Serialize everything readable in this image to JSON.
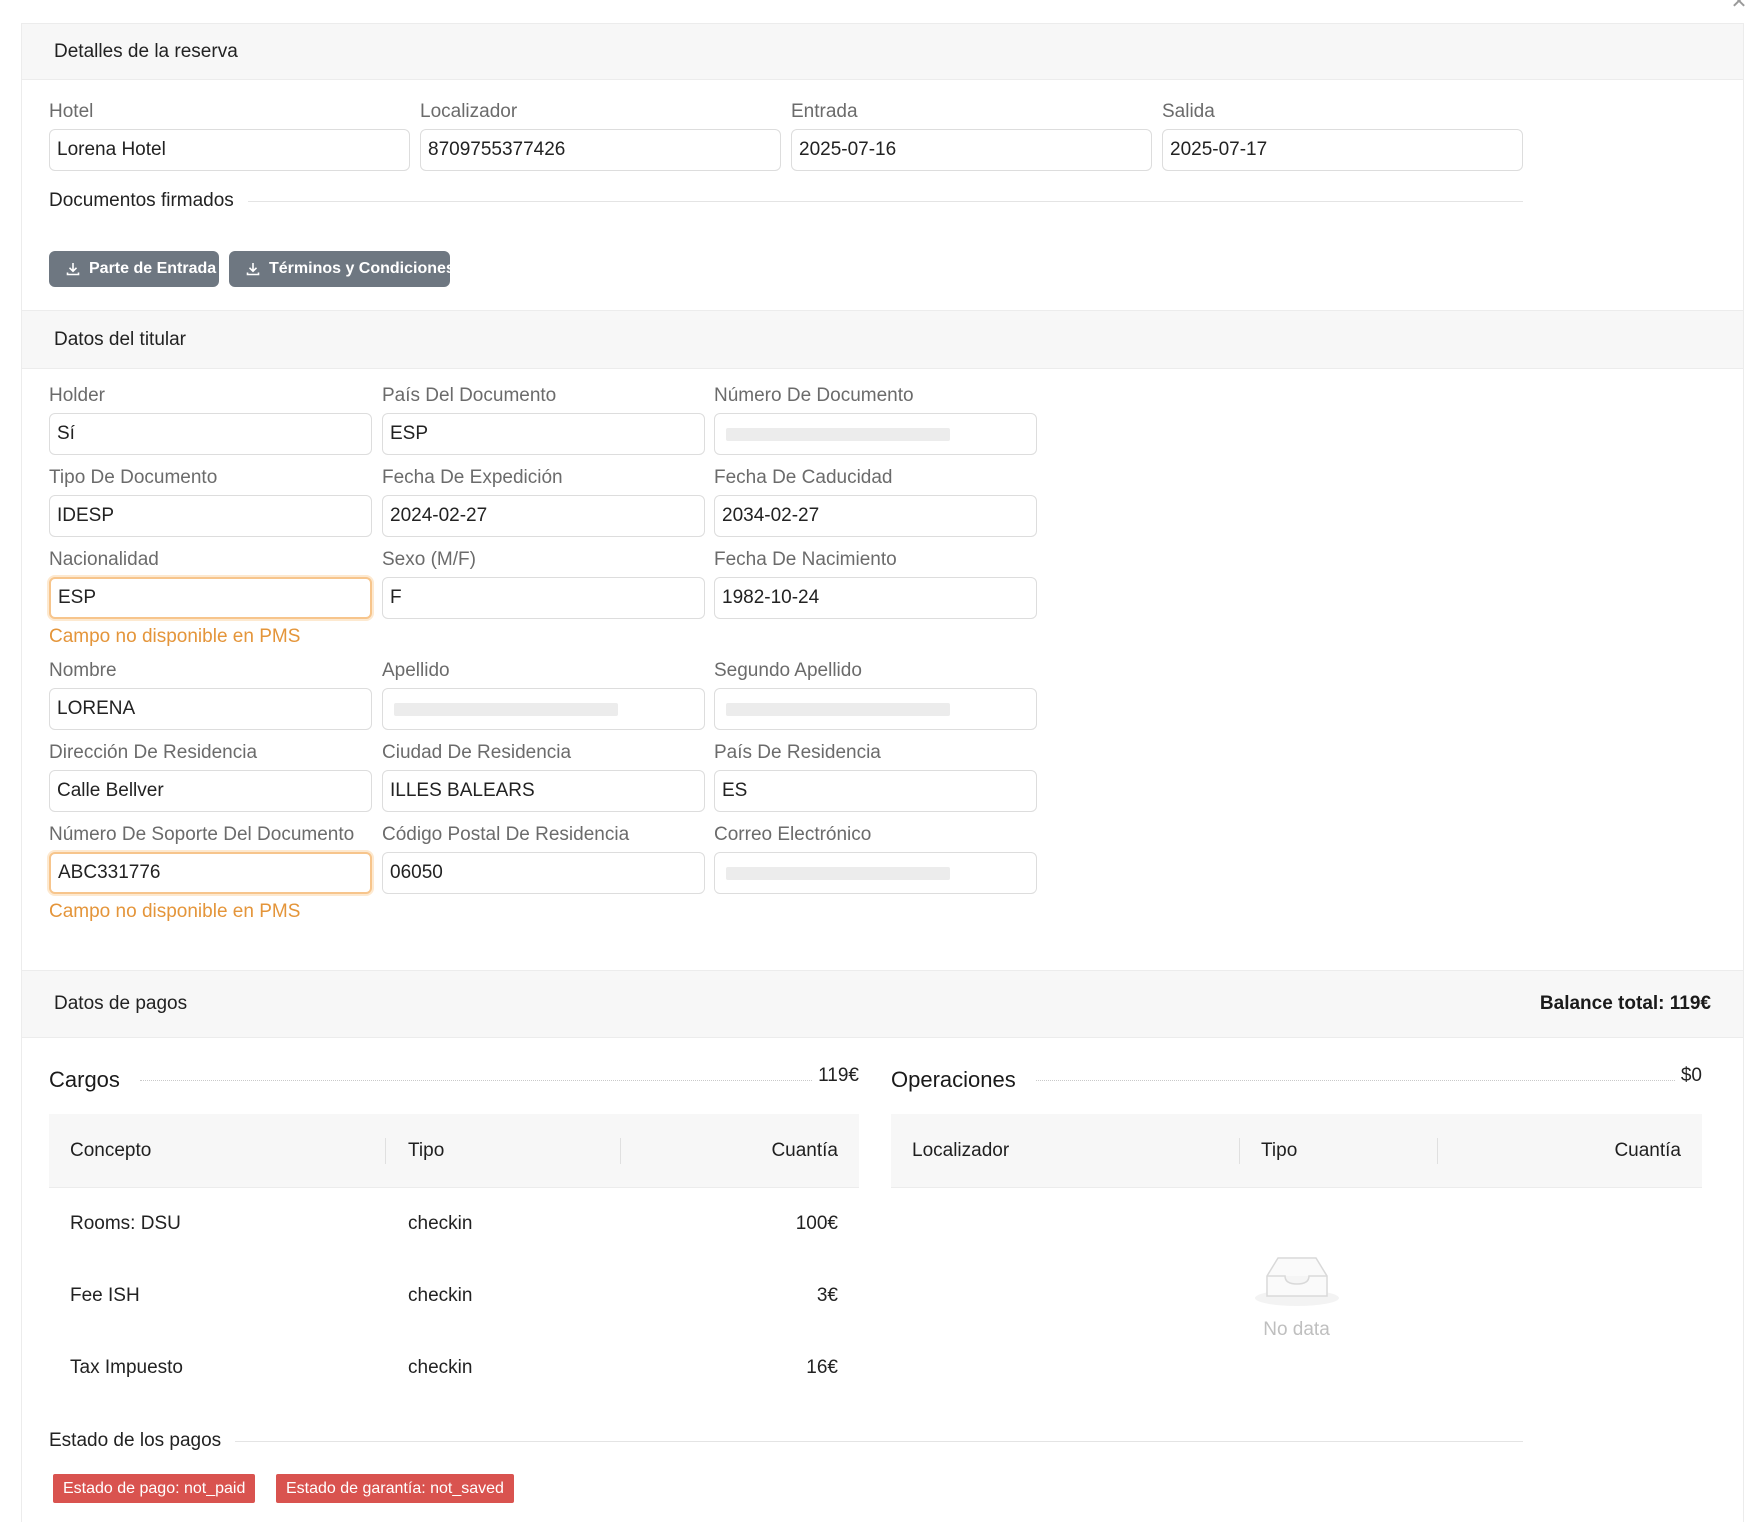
{
  "modal": {
    "close_icon": "close-icon"
  },
  "booking": {
    "title": "Detalles de la reserva",
    "fields": [
      {
        "label": "Hotel",
        "value": "Lorena Hotel"
      },
      {
        "label": "Localizador",
        "value": "8709755377426"
      },
      {
        "label": "Entrada",
        "value": "2025-07-16"
      },
      {
        "label": "Salida",
        "value": "2025-07-17"
      }
    ],
    "signed_docs_title": "Documentos firmados",
    "doc_buttons": [
      "Parte de Entrada",
      "Términos y Condiciones"
    ]
  },
  "holder": {
    "title": "Datos del titular",
    "warning_note": "Campo no disponible en PMS",
    "fields": [
      {
        "label": "Holder",
        "value": "Sí"
      },
      {
        "label": "País Del Documento",
        "value": "ESP"
      },
      {
        "label": "Número De Documento",
        "value": ""
      },
      {
        "label": "Tipo De Documento",
        "value": "IDESP"
      },
      {
        "label": "Fecha De Expedición",
        "value": "2024-02-27"
      },
      {
        "label": "Fecha De Caducidad",
        "value": "2034-02-27"
      },
      {
        "label": "Nacionalidad",
        "value": "ESP"
      },
      {
        "label": "Sexo (M/F)",
        "value": "F"
      },
      {
        "label": "Fecha De Nacimiento",
        "value": "1982-10-24"
      },
      {
        "label": "Nombre",
        "value": "LORENA"
      },
      {
        "label": "Apellido",
        "value": ""
      },
      {
        "label": "Segundo Apellido",
        "value": ""
      },
      {
        "label": "Dirección De Residencia",
        "value": "Calle Bellver"
      },
      {
        "label": "Ciudad De Residencia",
        "value": "ILLES BALEARS"
      },
      {
        "label": "País De Residencia",
        "value": "ES"
      },
      {
        "label": "Número De Soporte Del Documento",
        "value": "ABC331776"
      },
      {
        "label": "Código Postal De Residencia",
        "value": "06050"
      },
      {
        "label": "Correo Electrónico",
        "value": ""
      }
    ]
  },
  "payments": {
    "title": "Datos de pagos",
    "balance": "Balance total: 119€",
    "charges": {
      "title": "Cargos",
      "total": "119€",
      "headers": [
        "Concepto",
        "Tipo",
        "Cuantía"
      ],
      "rows": [
        [
          "Rooms: DSU",
          "checkin",
          "100€"
        ],
        [
          "Fee ISH",
          "checkin",
          "3€"
        ],
        [
          "Tax Impuesto",
          "checkin",
          "16€"
        ]
      ]
    },
    "operations": {
      "title": "Operaciones",
      "total": "$0",
      "headers": [
        "Localizador",
        "Tipo",
        "Cuantía"
      ],
      "empty_text": "No data",
      "empty_icon": "empty-inbox-icon"
    },
    "status_title": "Estado de los pagos",
    "tags": [
      "Estado de pago: not_paid",
      "Estado de garantía: not_saved"
    ],
    "colors": {
      "tag_bg": "#d9534f",
      "warning": "#e4953a",
      "button_bg": "#6e7781"
    }
  }
}
